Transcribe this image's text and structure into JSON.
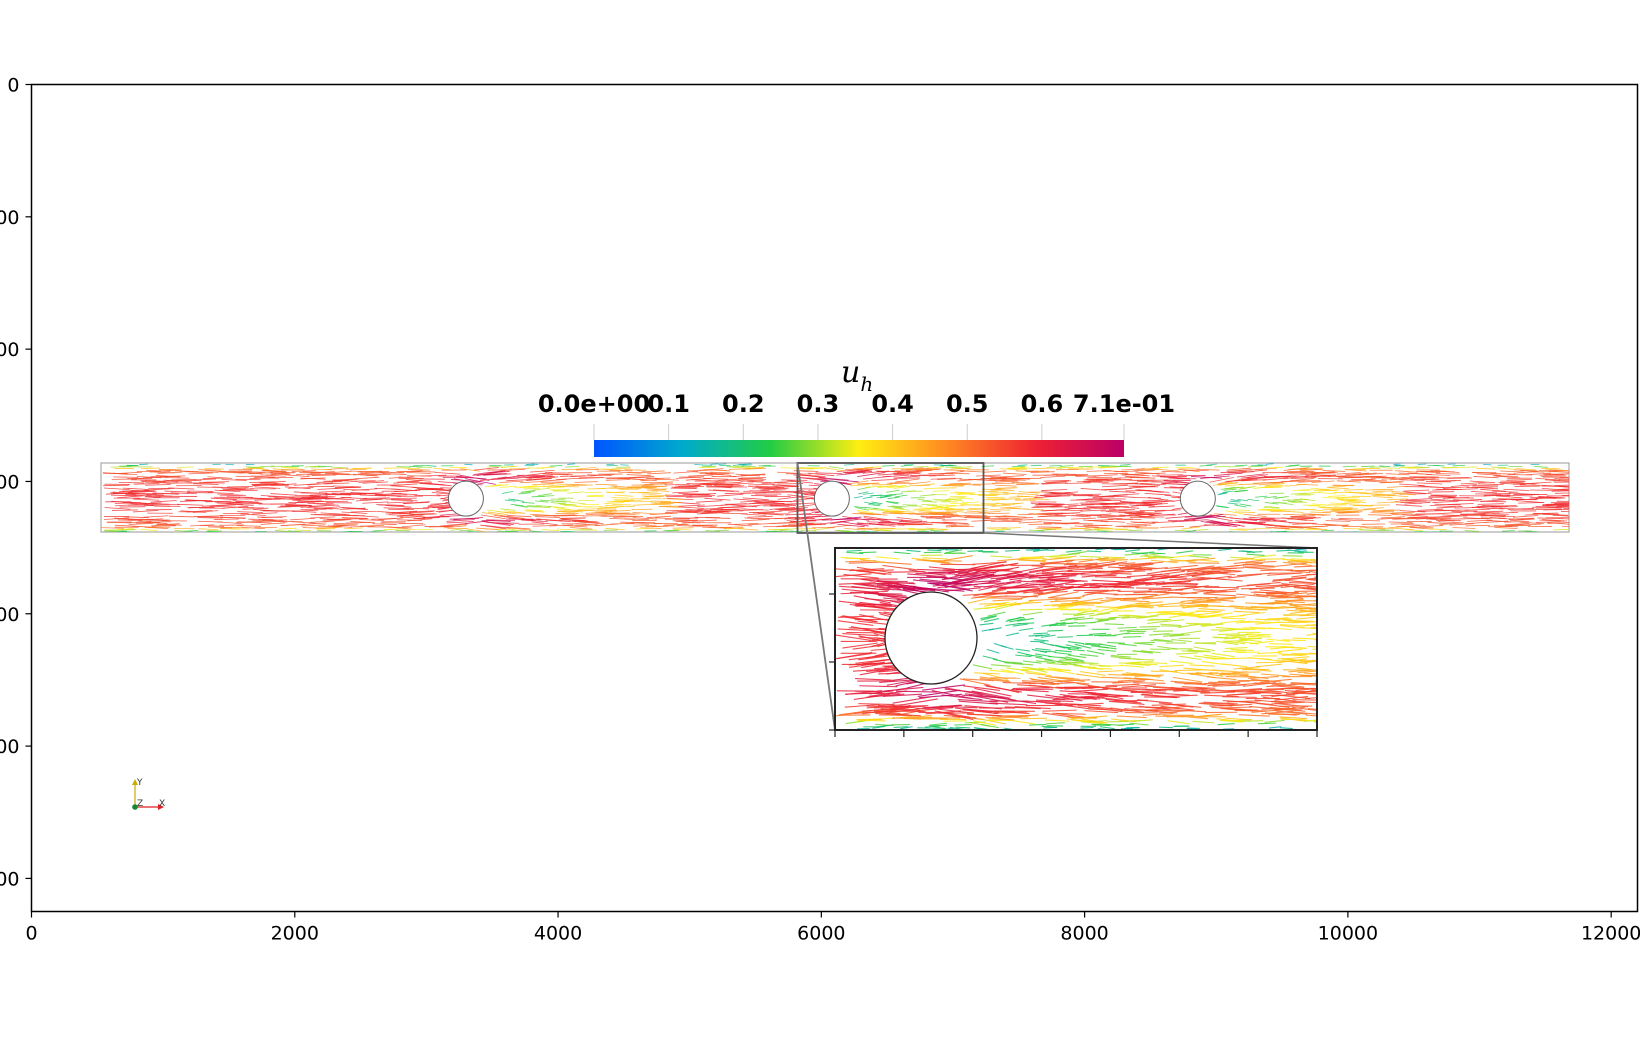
{
  "chart_data": {
    "type": "scatter",
    "title": "",
    "xlabel": "",
    "ylabel": "",
    "xlim": [
      0,
      12200
    ],
    "ylim": [
      6250,
      0
    ],
    "x_ticks": [
      0,
      2000,
      4000,
      6000,
      8000,
      10000,
      12000
    ],
    "x_tick_labels": [
      "0",
      "2000",
      "4000",
      "6000",
      "8000",
      "10000",
      "12000"
    ],
    "y_ticks": [
      0,
      1000,
      2000,
      3000,
      4000,
      5000,
      6000
    ],
    "y_tick_labels": [
      "0",
      "00",
      "00",
      "00",
      "00",
      "00",
      "00"
    ],
    "grid": false,
    "image": {
      "description_kind": "velocity-glyph field in a channel with three cylindrical obstacles",
      "channel_extent_x": [
        530,
        11640
      ],
      "channel_extent_y": [
        2870,
        3390
      ],
      "obstacle_centers_x": [
        3300,
        6080,
        8860
      ],
      "obstacle_center_y": [
        3130
      ]
    },
    "colorbar": {
      "title": "u",
      "title_subscript": "h",
      "tick_labels": [
        "0.0e+00",
        "0.1",
        "0.2",
        "0.3",
        "0.4",
        "0.5",
        "0.6",
        "7.1e-01"
      ],
      "tick_values": [
        0.0,
        0.1,
        0.2,
        0.3,
        0.4,
        0.5,
        0.6,
        0.71
      ],
      "range": [
        0.0,
        0.71
      ],
      "colors": [
        "#0055ff",
        "#00aacc",
        "#22cc44",
        "#ffee11",
        "#ff8822",
        "#ee2233",
        "#bb0066"
      ]
    },
    "inset": {
      "source_region_x": [
        5800,
        7200
      ],
      "source_region_y": [
        2870,
        3390
      ],
      "zoom_of_obstacle_index": 1
    },
    "orientation_axes": [
      "Y",
      "Z",
      "X"
    ],
    "orientation_colors": {
      "x": "#dd2222",
      "y": "#ccaa00",
      "z": "#118833"
    }
  }
}
